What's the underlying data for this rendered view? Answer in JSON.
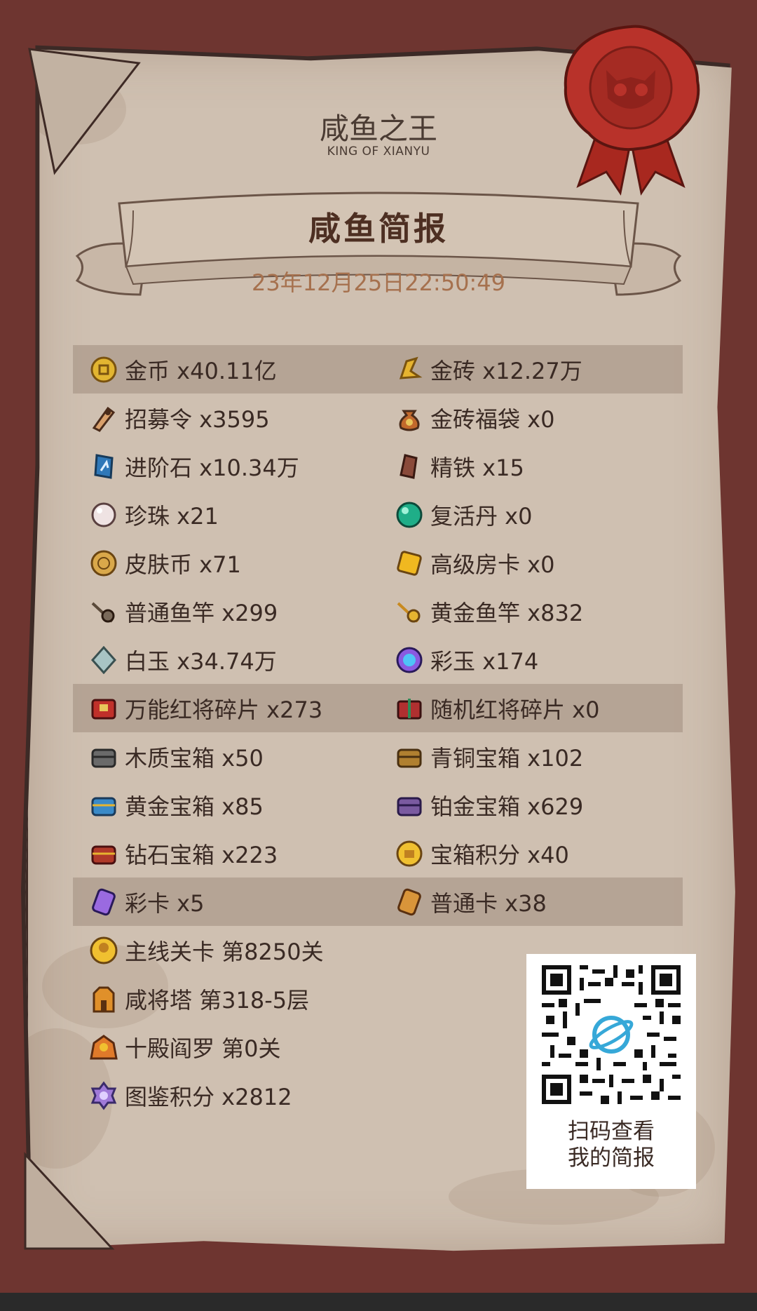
{
  "header": {
    "title": "咸鱼之王",
    "subtitle": "KING OF XIANYU"
  },
  "report": {
    "title": "咸鱼简报",
    "datetime": "23年12月25日22:50:49"
  },
  "colors": {
    "background": "#6e3530",
    "paper": "#cfc0b1",
    "highlight_row": "#b8a799",
    "date_text": "#a6714e",
    "seal": "#b8322a"
  },
  "stats": [
    {
      "label": "金币 x40.11亿",
      "icon": "gold-coin-icon",
      "highlight": true
    },
    {
      "label": "金砖 x12.27万",
      "icon": "gold-brick-icon",
      "highlight": true
    },
    {
      "label": "招募令 x3595",
      "icon": "recruit-token-icon",
      "highlight": false
    },
    {
      "label": "金砖福袋 x0",
      "icon": "gold-brick-bag-icon",
      "highlight": false
    },
    {
      "label": "进阶石 x10.34万",
      "icon": "advance-stone-icon",
      "highlight": false
    },
    {
      "label": "精铁 x15",
      "icon": "refined-iron-icon",
      "highlight": false
    },
    {
      "label": "珍珠 x21",
      "icon": "pearl-icon",
      "highlight": false
    },
    {
      "label": "复活丹 x0",
      "icon": "revive-pill-icon",
      "highlight": false
    },
    {
      "label": "皮肤币 x71",
      "icon": "skin-coin-icon",
      "highlight": false
    },
    {
      "label": "高级房卡 x0",
      "icon": "premium-room-card-icon",
      "highlight": false
    },
    {
      "label": "普通鱼竿 x299",
      "icon": "normal-fishing-rod-icon",
      "highlight": false
    },
    {
      "label": "黄金鱼竿 x832",
      "icon": "golden-fishing-rod-icon",
      "highlight": false
    },
    {
      "label": "白玉 x34.74万",
      "icon": "white-jade-icon",
      "highlight": false
    },
    {
      "label": "彩玉 x174",
      "icon": "colored-jade-icon",
      "highlight": false
    },
    {
      "label": "万能红将碎片 x273",
      "icon": "universal-red-shard-icon",
      "highlight": true
    },
    {
      "label": "随机红将碎片 x0",
      "icon": "random-red-shard-icon",
      "highlight": true
    },
    {
      "label": "木质宝箱 x50",
      "icon": "wooden-chest-icon",
      "highlight": false
    },
    {
      "label": "青铜宝箱 x102",
      "icon": "bronze-chest-icon",
      "highlight": false
    },
    {
      "label": "黄金宝箱 x85",
      "icon": "gold-chest-icon",
      "highlight": false
    },
    {
      "label": "铂金宝箱 x629",
      "icon": "platinum-chest-icon",
      "highlight": false
    },
    {
      "label": "钻石宝箱 x223",
      "icon": "diamond-chest-icon",
      "highlight": false
    },
    {
      "label": "宝箱积分 x40",
      "icon": "chest-points-icon",
      "highlight": false
    },
    {
      "label": "彩卡 x5",
      "icon": "colored-card-icon",
      "highlight": true
    },
    {
      "label": "普通卡 x38",
      "icon": "normal-card-icon",
      "highlight": true
    }
  ],
  "progress": [
    {
      "label": "主线关卡 第8250关",
      "icon": "main-stage-icon"
    },
    {
      "label": "咸将塔 第318-5层",
      "icon": "tower-icon"
    },
    {
      "label": "十殿阎罗 第0关",
      "icon": "yama-palace-icon"
    },
    {
      "label": "图鉴积分 x2812",
      "icon": "collection-points-icon"
    }
  ],
  "qr": {
    "caption_line1": "扫码查看",
    "caption_line2": "我的简报"
  }
}
